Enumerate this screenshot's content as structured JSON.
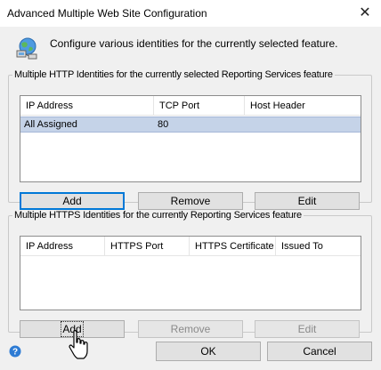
{
  "window": {
    "title": "Advanced Multiple Web Site Configuration",
    "close_glyph": "✕"
  },
  "intro": {
    "icon": "globe-network-icon",
    "text": "Configure various identities for the currently selected feature."
  },
  "http_group": {
    "legend": "Multiple HTTP Identities for the currently selected Reporting Services feature",
    "columns": [
      "IP Address",
      "TCP Port",
      "Host Header"
    ],
    "rows": [
      {
        "ip": "All Assigned",
        "port": "80",
        "host": ""
      }
    ],
    "buttons": {
      "add": "Add",
      "remove": "Remove",
      "edit": "Edit"
    }
  },
  "https_group": {
    "legend": "Multiple HTTPS Identities for the currently Reporting Services feature",
    "columns": [
      "IP Address",
      "HTTPS Port",
      "HTTPS Certificate",
      "Issued To"
    ],
    "rows": [],
    "buttons": {
      "add": "Add",
      "remove": "Remove",
      "edit": "Edit"
    }
  },
  "footer": {
    "ok": "OK",
    "cancel": "Cancel",
    "help_icon": "help-icon"
  },
  "colors": {
    "selection": "#c5d3e8",
    "focus_border": "#0078d7",
    "dialog_bg": "#f0f0f0"
  }
}
